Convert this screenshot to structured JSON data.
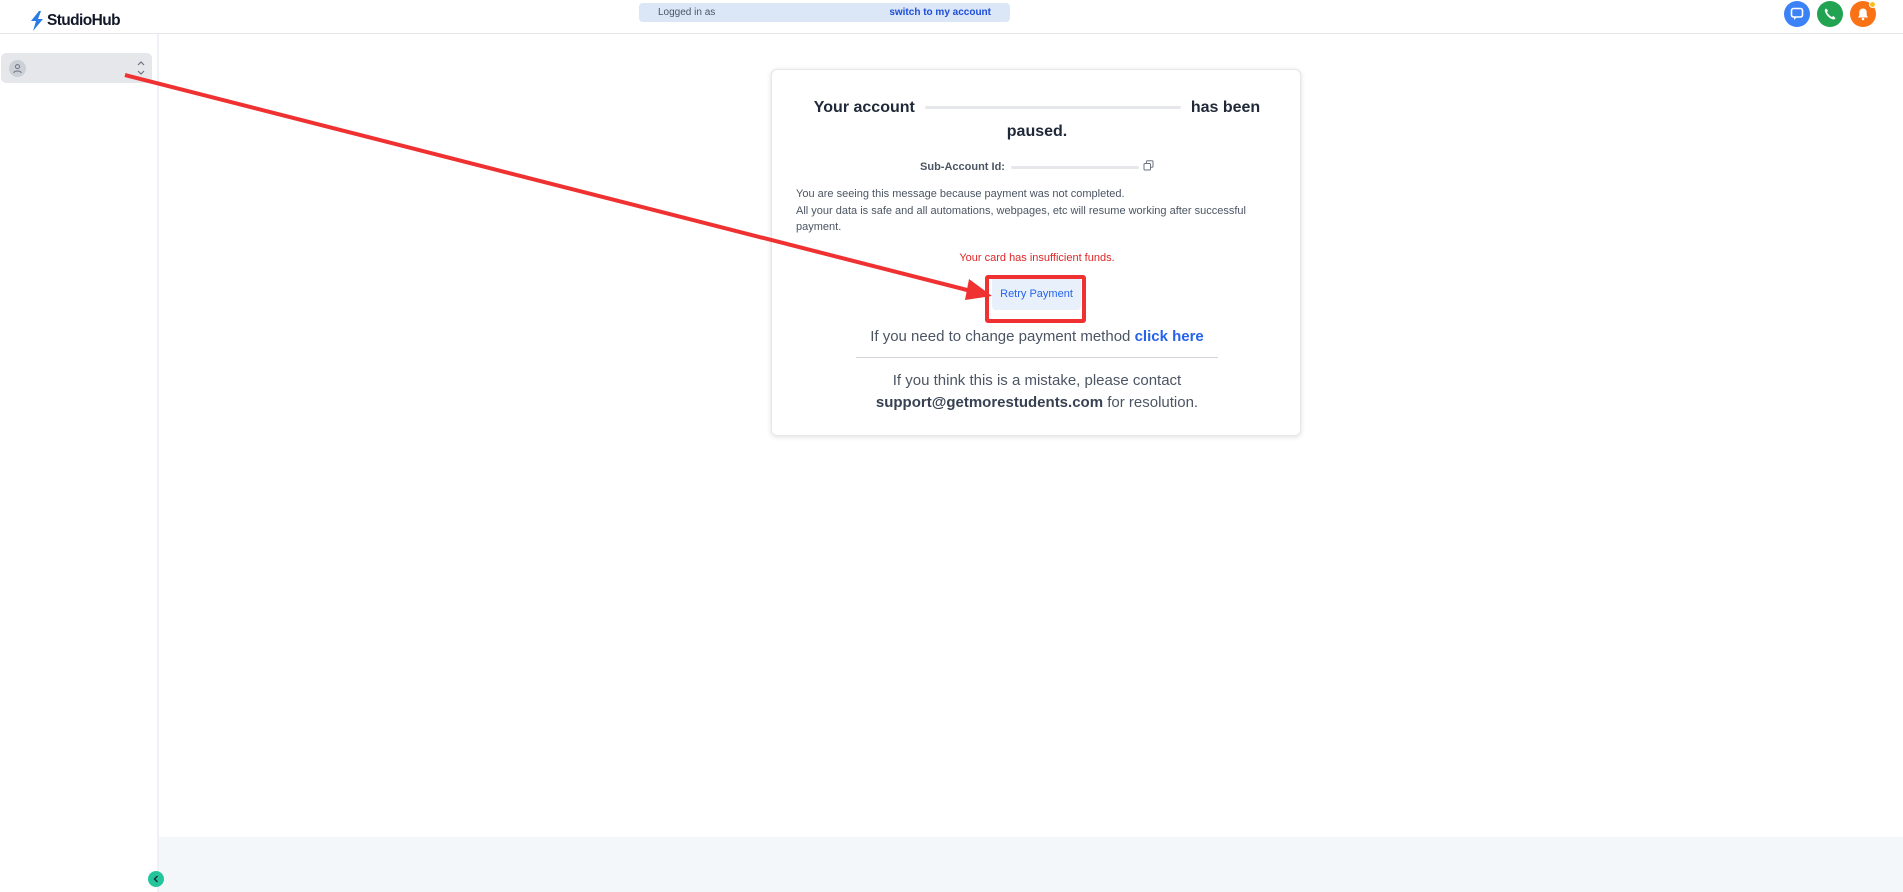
{
  "header": {
    "logo_text": "StudioHub",
    "login_prefix": "Logged in as",
    "switch_link": "switch to my account"
  },
  "icons": {
    "chat": "chat-icon",
    "phone": "phone-icon",
    "bell": "bell-icon",
    "avatar": "user-icon",
    "copy": "copy-icon",
    "collapse": "chevron-left-icon"
  },
  "card": {
    "title_part1": "Your account",
    "title_part2": "has been",
    "title_part3": "paused.",
    "subaccount_label": "Sub-Account Id:",
    "message_line1": "You are seeing this message because payment was not completed.",
    "message_line2": "All your data is safe and all automations, webpages, etc will resume working after successful payment.",
    "error": "Your card has insufficient funds.",
    "retry_button": "Retry Payment",
    "change_method_text": "If you need to change payment method",
    "change_method_link": "click here",
    "mistake_text": "If you think this is a mistake, please contact",
    "support_email": "support@getmorestudents.com",
    "mistake_suffix": "for resolution."
  },
  "colors": {
    "accent": "#2563eb",
    "error": "#dc2626",
    "annotation": "#ef3131",
    "chat": "#3b82f6",
    "phone": "#22a351",
    "bell": "#f97316"
  }
}
